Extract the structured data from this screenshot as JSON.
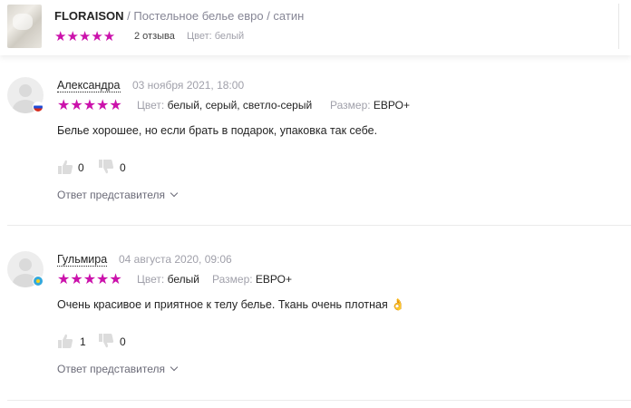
{
  "header": {
    "brand": "FLORAISON",
    "breadcrumb": " / Постельное белье евро / сатин",
    "stars": "★★★★★",
    "reviews_count": "2 отзыва",
    "color_label": "Цвет: белый",
    "rating": 5
  },
  "reviews": [
    {
      "author": "Александра",
      "date": "03 ноября 2021, 18:00",
      "stars": "★★★★★",
      "rating": 5,
      "color_label": "Цвет:",
      "color_value": "белый, серый, светло-серый",
      "size_label": "Размер:",
      "size_value": "ЕВРО+",
      "text": "Белье хорошее, но если брать в подарок, упаковка так себе.",
      "likes": "0",
      "dislikes": "0",
      "reply_link": "Ответ представителя",
      "country_flag": "ru"
    },
    {
      "author": "Гульмира",
      "date": "04 августа 2020, 09:06",
      "stars": "★★★★★",
      "rating": 5,
      "color_label": "Цвет:",
      "color_value": "белый",
      "size_label": "Размер:",
      "size_value": "ЕВРО+",
      "text": "Очень красивое и приятное к телу белье. Ткань очень плотная 👌",
      "likes": "1",
      "dislikes": "0",
      "reply_link": "Ответ представителя",
      "country_flag": "kz"
    }
  ],
  "colors": {
    "star": "#cb11ab",
    "muted": "#a0a0aa",
    "text": "#242424"
  }
}
